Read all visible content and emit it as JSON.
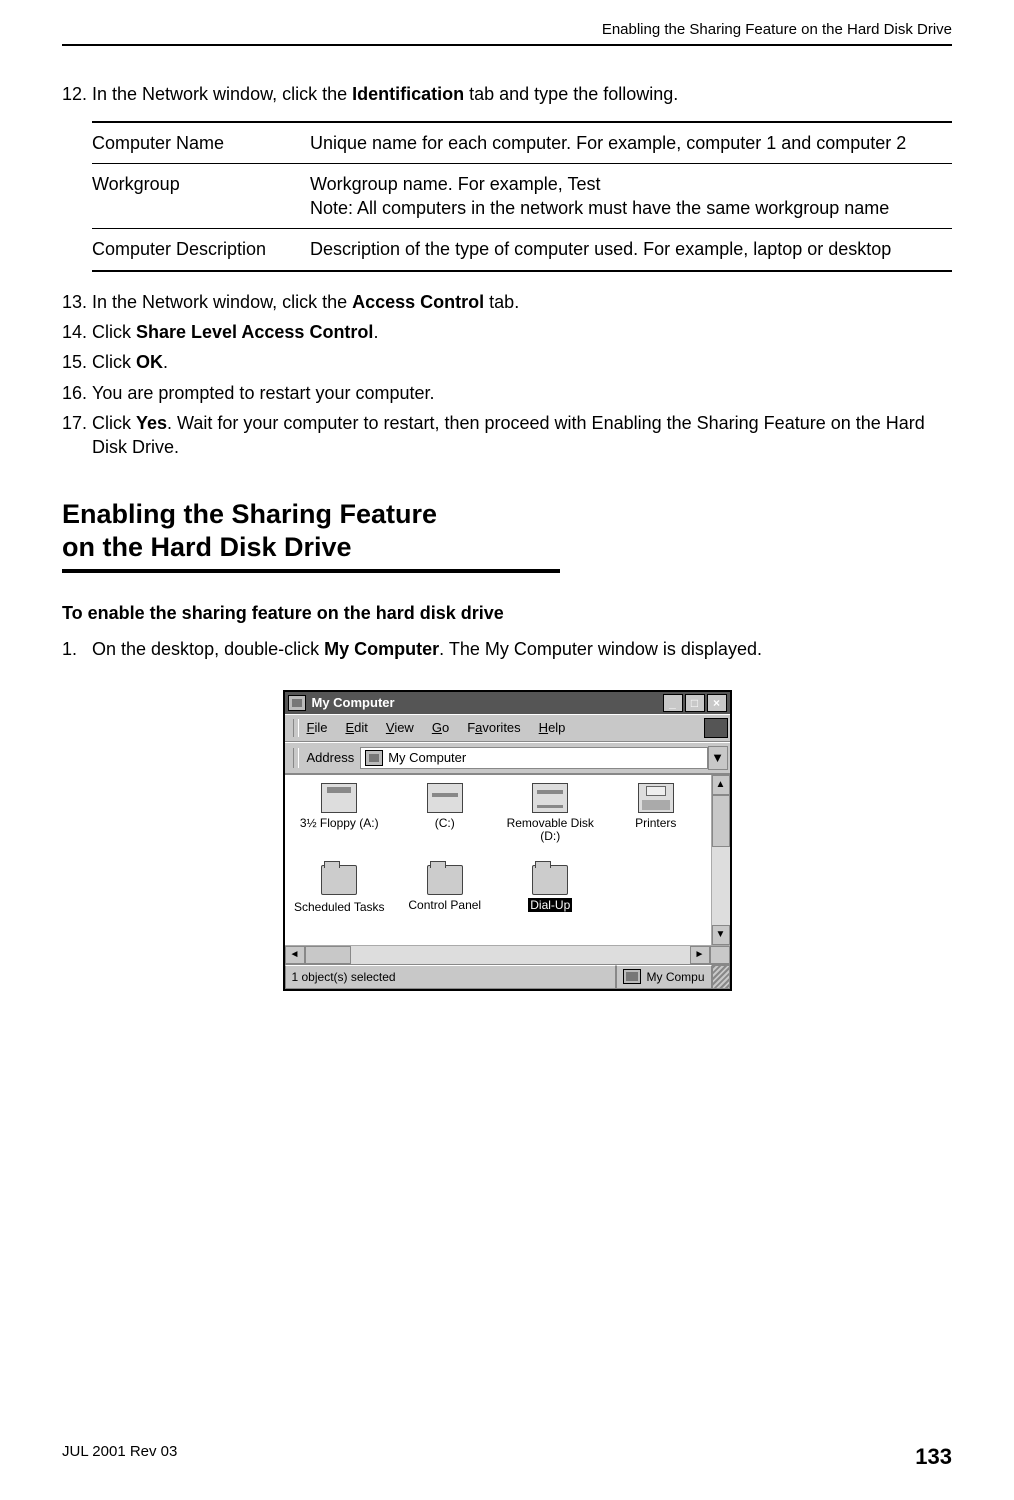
{
  "header": {
    "running": "Enabling the Sharing Feature on the Hard Disk Drive"
  },
  "steps1": [
    {
      "n": "12.",
      "pre": "In the Network window, click the ",
      "bold": "Identification",
      "post": " tab and type the following."
    }
  ],
  "idTable": [
    {
      "label": "Computer Name",
      "desc": "Unique name for each computer. For example, computer 1 and computer 2"
    },
    {
      "label": "Workgroup",
      "desc": "Workgroup name. For example, Test\nNote: All computers in the network must have the same workgroup name"
    },
    {
      "label": "Computer Description",
      "desc": "Description of the type of computer used. For example, laptop or desktop"
    }
  ],
  "steps2": [
    {
      "n": "13.",
      "parts": [
        {
          "t": "In the Network window, click the "
        },
        {
          "b": "Access Control"
        },
        {
          "t": " tab."
        }
      ]
    },
    {
      "n": "14.",
      "parts": [
        {
          "t": "Click "
        },
        {
          "b": "Share Level Access Control"
        },
        {
          "t": "."
        }
      ]
    },
    {
      "n": "15.",
      "parts": [
        {
          "t": "Click "
        },
        {
          "b": "OK"
        },
        {
          "t": "."
        }
      ]
    },
    {
      "n": "16.",
      "parts": [
        {
          "t": "You are prompted to restart your computer."
        }
      ]
    },
    {
      "n": "17.",
      "parts": [
        {
          "t": "Click "
        },
        {
          "b": "Yes"
        },
        {
          "t": ". Wait for your computer to restart, then proceed with Enabling the Sharing Feature on the Hard Disk Drive."
        }
      ]
    }
  ],
  "section": {
    "title1": "Enabling the Sharing Feature",
    "title2": "on the Hard Disk Drive",
    "subhead": "To enable the sharing feature on the hard disk drive"
  },
  "steps3": [
    {
      "n": "1.",
      "parts": [
        {
          "t": "On the desktop, double-click "
        },
        {
          "b": "My Computer"
        },
        {
          "t": ". The My Computer window is displayed."
        }
      ]
    }
  ],
  "window": {
    "title": "My Computer",
    "menus": [
      "File",
      "Edit",
      "View",
      "Go",
      "Favorites",
      "Help"
    ],
    "menuAccel": [
      "F",
      "E",
      "V",
      "G",
      "a",
      "H"
    ],
    "addressLabel": "Address",
    "addressValue": "My Computer",
    "icons": [
      {
        "label": "3½ Floppy (A:)",
        "cls": "floppy"
      },
      {
        "label": "(C:)",
        "cls": "hdd"
      },
      {
        "label": "Removable Disk (D:)",
        "cls": "remov"
      },
      {
        "label": "Printers",
        "cls": "printer"
      },
      {
        "label": "Scheduled Tasks",
        "cls": "folder",
        "cut": true
      },
      {
        "label": "Control Panel",
        "cls": "folder"
      },
      {
        "label": "Dial-Up",
        "cls": "folder",
        "sel": true
      }
    ],
    "statusLeft": "1 object(s) selected",
    "statusRight": "My Compu"
  },
  "footer": {
    "left": "JUL 2001 Rev 03",
    "page": "133"
  }
}
